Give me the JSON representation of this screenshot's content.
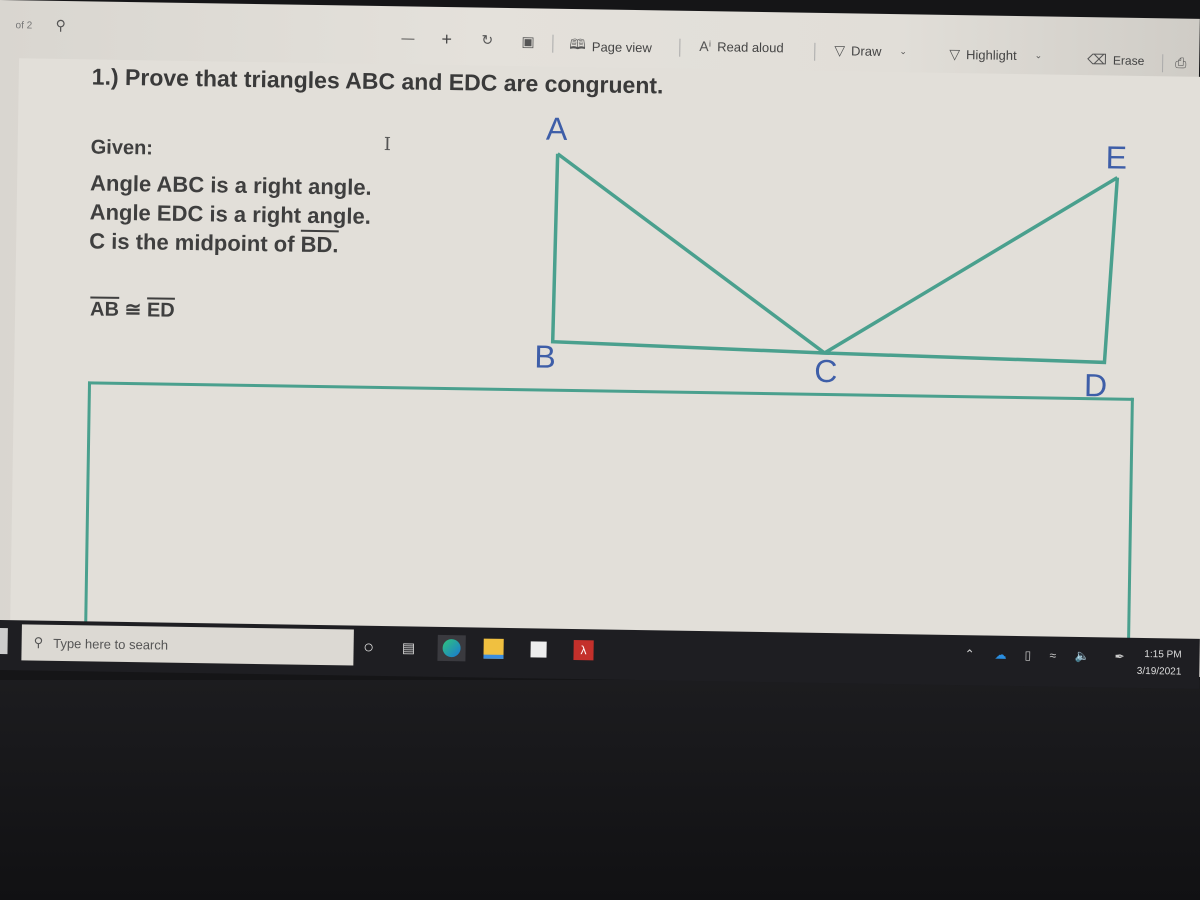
{
  "viewer": {
    "page_indicator": "of 2",
    "toolbar": {
      "zoom_out": "—",
      "zoom_in": "+",
      "page_view": "Page view",
      "read_aloud": "Read aloud",
      "draw": "Draw",
      "highlight": "Highlight",
      "erase": "Erase"
    }
  },
  "document": {
    "title": "1.) Prove that triangles ABC and EDC are congruent.",
    "given_label": "Given:",
    "given": [
      "Angle ABC is a right angle.",
      "Angle EDC is a right angle.",
      "C is the midpoint of "
    ],
    "midpoint_segment": "BD.",
    "congruence": {
      "left": "AB",
      "symbol": "≅",
      "right": "ED"
    },
    "figure": {
      "line_color": "#4aa08e",
      "label_color": "#3e5ea8",
      "vertices": {
        "A": "A",
        "B": "B",
        "C": "C",
        "D": "D",
        "E": "E"
      }
    }
  },
  "taskbar": {
    "search_placeholder": "Type here to search",
    "time": "1:15 PM",
    "date": "3/19/2021"
  }
}
